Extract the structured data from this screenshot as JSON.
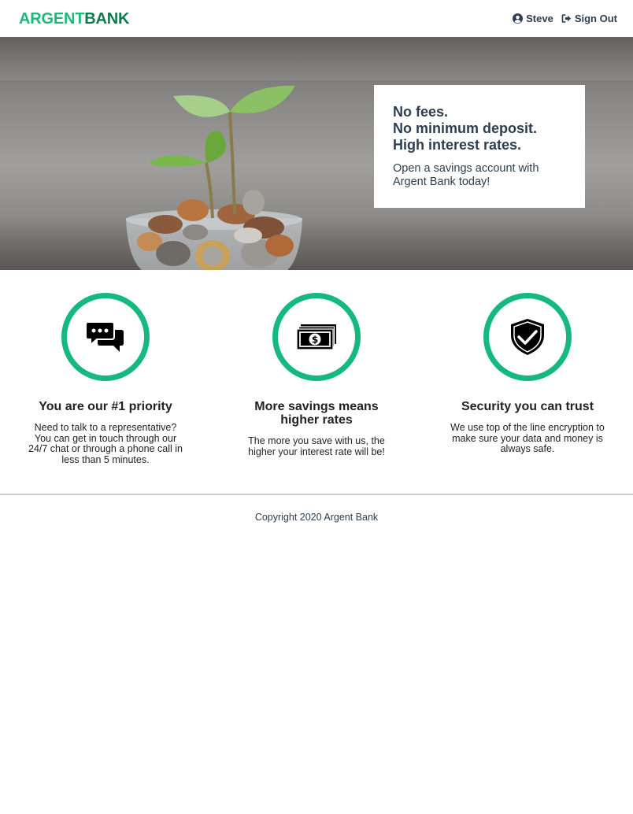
{
  "nav": {
    "logo_part1": "ARGENT",
    "logo_part2": "BANK",
    "user_icon": "user-circle-icon",
    "user_name": "Steve",
    "signout_icon": "sign-out-icon",
    "signout_label": "Sign Out"
  },
  "hero": {
    "subtitle_1": "No fees.",
    "subtitle_2": "No minimum deposit.",
    "subtitle_3": "High interest rates.",
    "text": "Open a savings account with Argent Bank today!"
  },
  "features": [
    {
      "icon": "chat-icon",
      "title": "You are our #1 priority",
      "text": "Need to talk to a representative? You can get in touch through our 24/7 chat or through a phone call in less than 5 minutes."
    },
    {
      "icon": "money-icon",
      "title": "More savings means higher rates",
      "text": "The more you save with us, the higher your interest rate will be!"
    },
    {
      "icon": "security-icon",
      "title": "Security you can trust",
      "text": "We use top of the line encryption to make sure your data and money is always safe."
    }
  ],
  "footer": {
    "copyright": "Copyright 2020 Argent Bank"
  },
  "colors": {
    "brand_green": "#1fb77a",
    "brand_dark_green": "#0f7a4f",
    "ring_green": "#15b97d",
    "text_dark": "#2c3e50"
  }
}
